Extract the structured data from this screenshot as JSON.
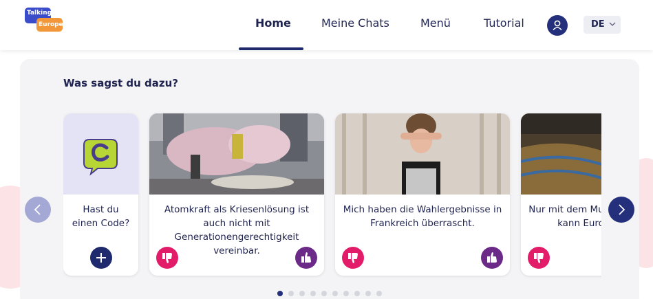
{
  "header": {
    "logo": {
      "line1": "Talking",
      "line2": "Europe",
      "blue": "#3a4cc9",
      "orange": "#f2963a"
    },
    "nav": [
      {
        "label": "Home",
        "active": true
      },
      {
        "label": "Meine Chats",
        "active": false
      },
      {
        "label": "Menü",
        "active": false
      },
      {
        "label": "Tutorial",
        "active": false
      }
    ],
    "user_icon": "user-icon",
    "language": "DE"
  },
  "main": {
    "title": "Was sagst du dazu?",
    "code_card": {
      "label": "Hast du einen Code?",
      "icon": "chat-c-icon",
      "button_icon": "plus-icon"
    },
    "cards": [
      {
        "text": "Atomkraft als Kriesenlösung ist auch nicht mit Generationengerechtigkeit vereinbar."
      },
      {
        "text": "Mich haben die Wahlergebnisse in Frankreich überrascht."
      },
      {
        "text": "Nur mit dem Mut zur Veränderung kann Europa handeln."
      }
    ],
    "pagination": {
      "total": 10,
      "current": 1
    }
  },
  "colors": {
    "primary": "#24307c",
    "thumbs_down": "#e31c6a",
    "thumbs_up": "#6b2a88",
    "panel": "#f4f4f6"
  }
}
